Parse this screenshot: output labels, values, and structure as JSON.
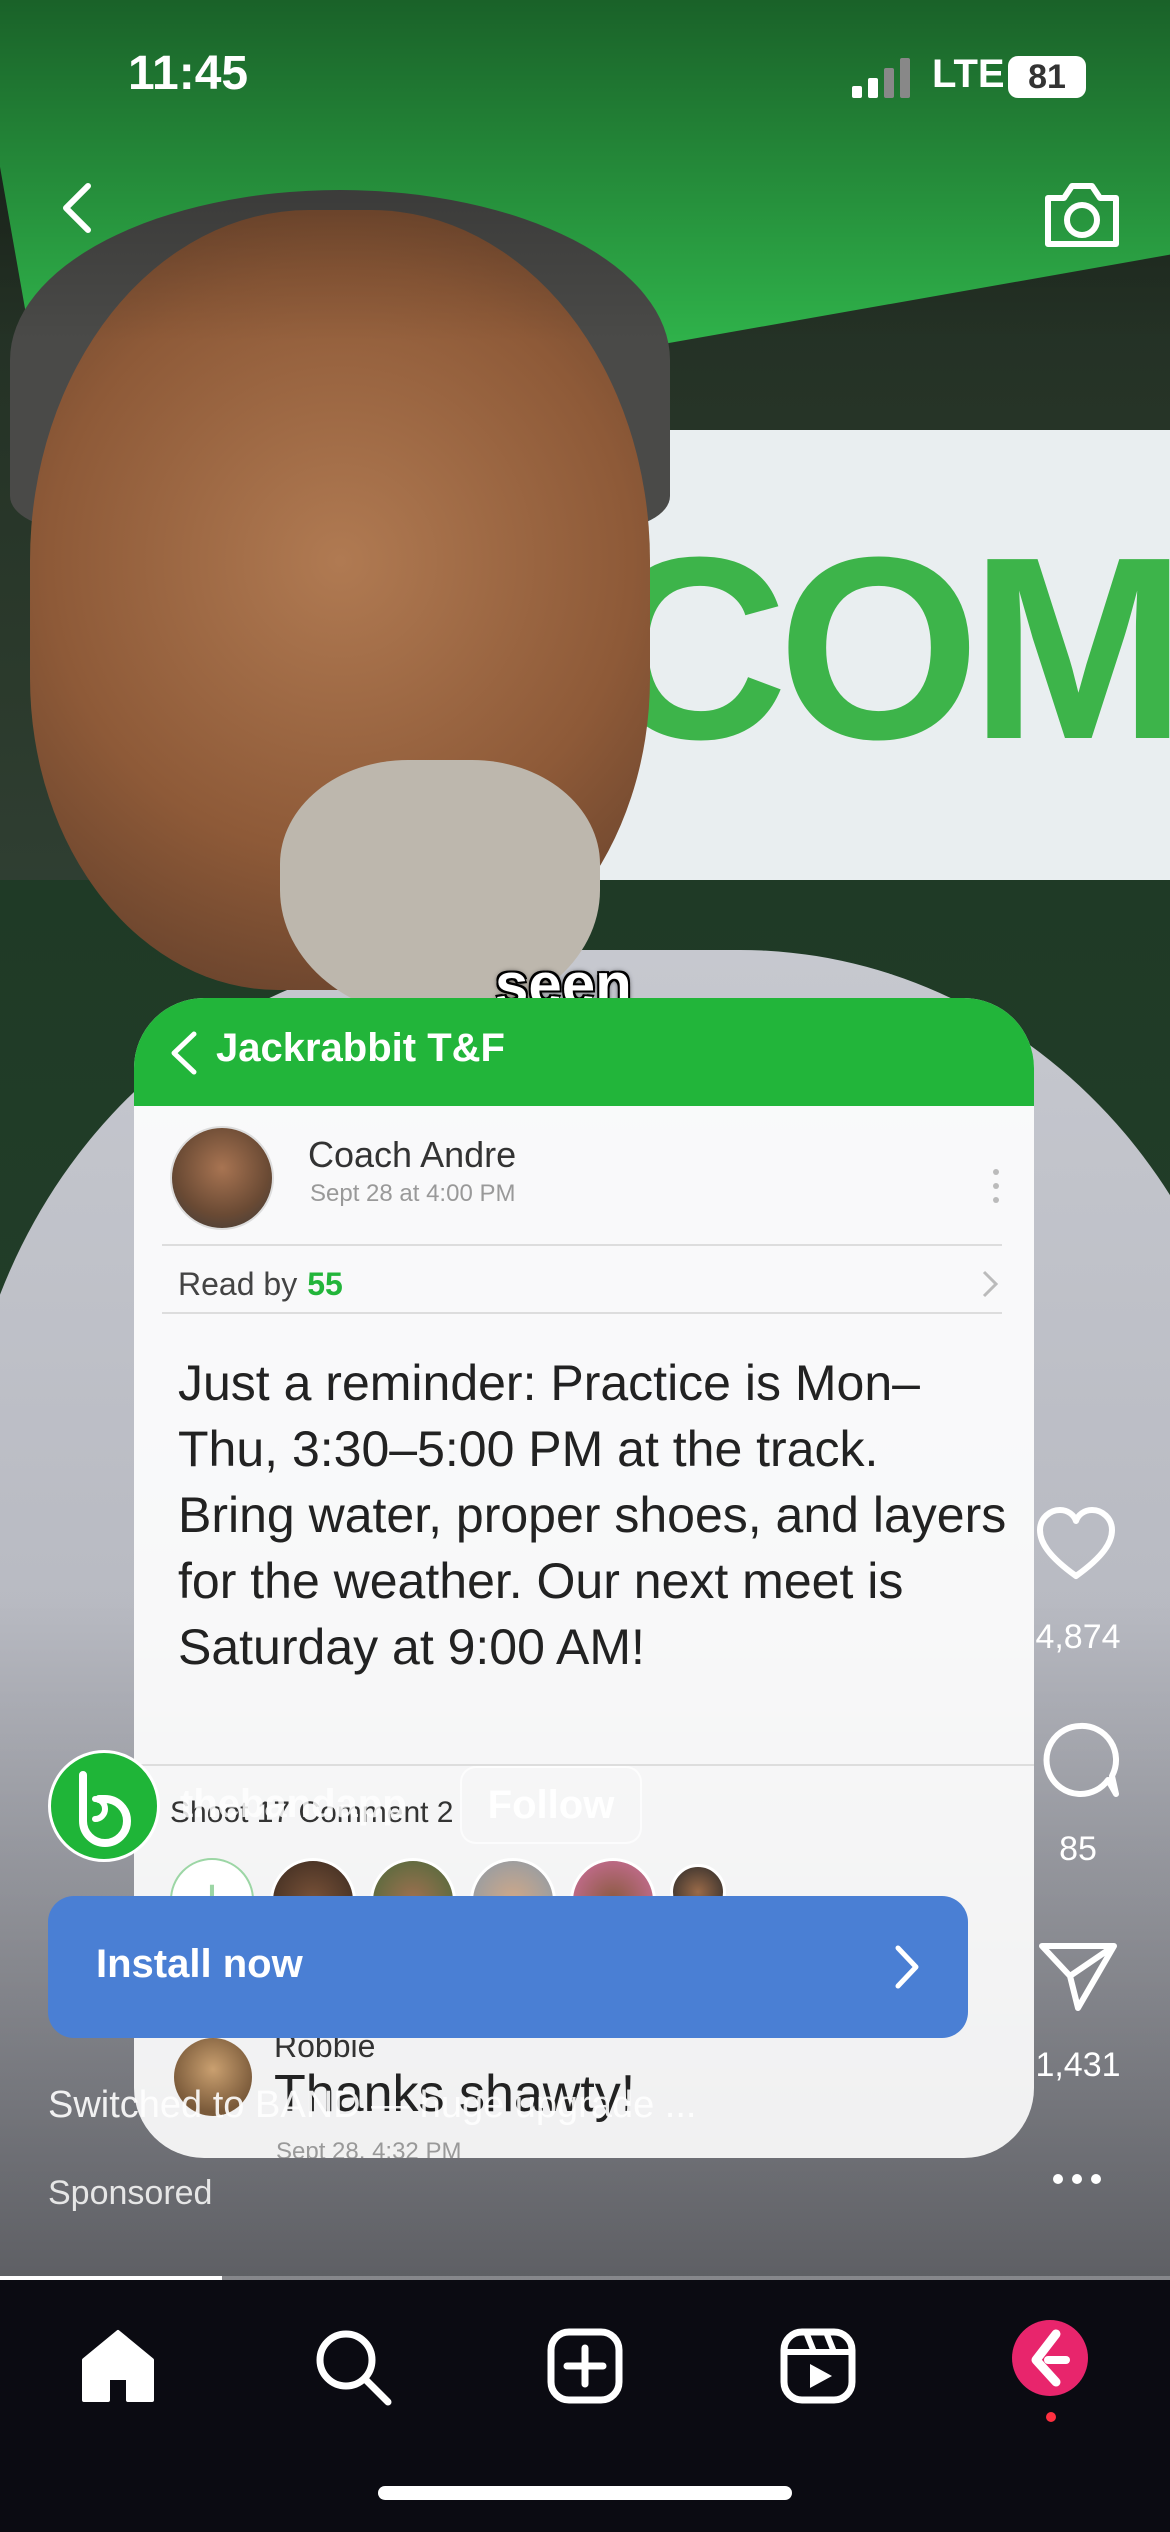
{
  "status_bar": {
    "time": "11:45",
    "network": "LTE",
    "battery": "81"
  },
  "top_bar": {
    "back_icon": "chevron-left-icon",
    "camera_icon": "camera-icon"
  },
  "overlay_caption": "seen",
  "embedded_app": {
    "group_title": "Jackrabbit T&F",
    "post": {
      "author": "Coach Andre",
      "date": "Sept 28 at 4:00 PM",
      "read_by_label": "Read by",
      "read_by_count": "55",
      "body": "Just a reminder: Practice is Mon–Thu, 3:30–5:00 PM at the track. Bring water, proper shoes, and layers for the weather. Our next meet is Saturday at 9:00 AM!",
      "stats": "Shoot 17  Comment 2",
      "add_label": "+"
    },
    "comment": {
      "name": "Robbie",
      "text": "Thanks shawty!",
      "meta": "Sept 28, 4:32 PM"
    }
  },
  "account": {
    "name": "thebandapp",
    "follow_label": "Follow"
  },
  "cta": {
    "label": "Install now",
    "icon": "chevron-right-icon"
  },
  "caption": "Switched to BAND — huge upgrade ...",
  "sponsored_label": "Sponsored",
  "actions": {
    "likes": "4,874",
    "comments": "85",
    "shares": "1,431"
  },
  "progress": 0.19,
  "nav": {
    "items": [
      "home-icon",
      "search-icon",
      "create-icon",
      "reels-icon",
      "profile-avatar"
    ]
  },
  "colors": {
    "band_green": "#22b53a",
    "install_blue": "#4a7fd4",
    "nav_bg": "#0b0b12",
    "profile_pink": "#e8256c"
  }
}
